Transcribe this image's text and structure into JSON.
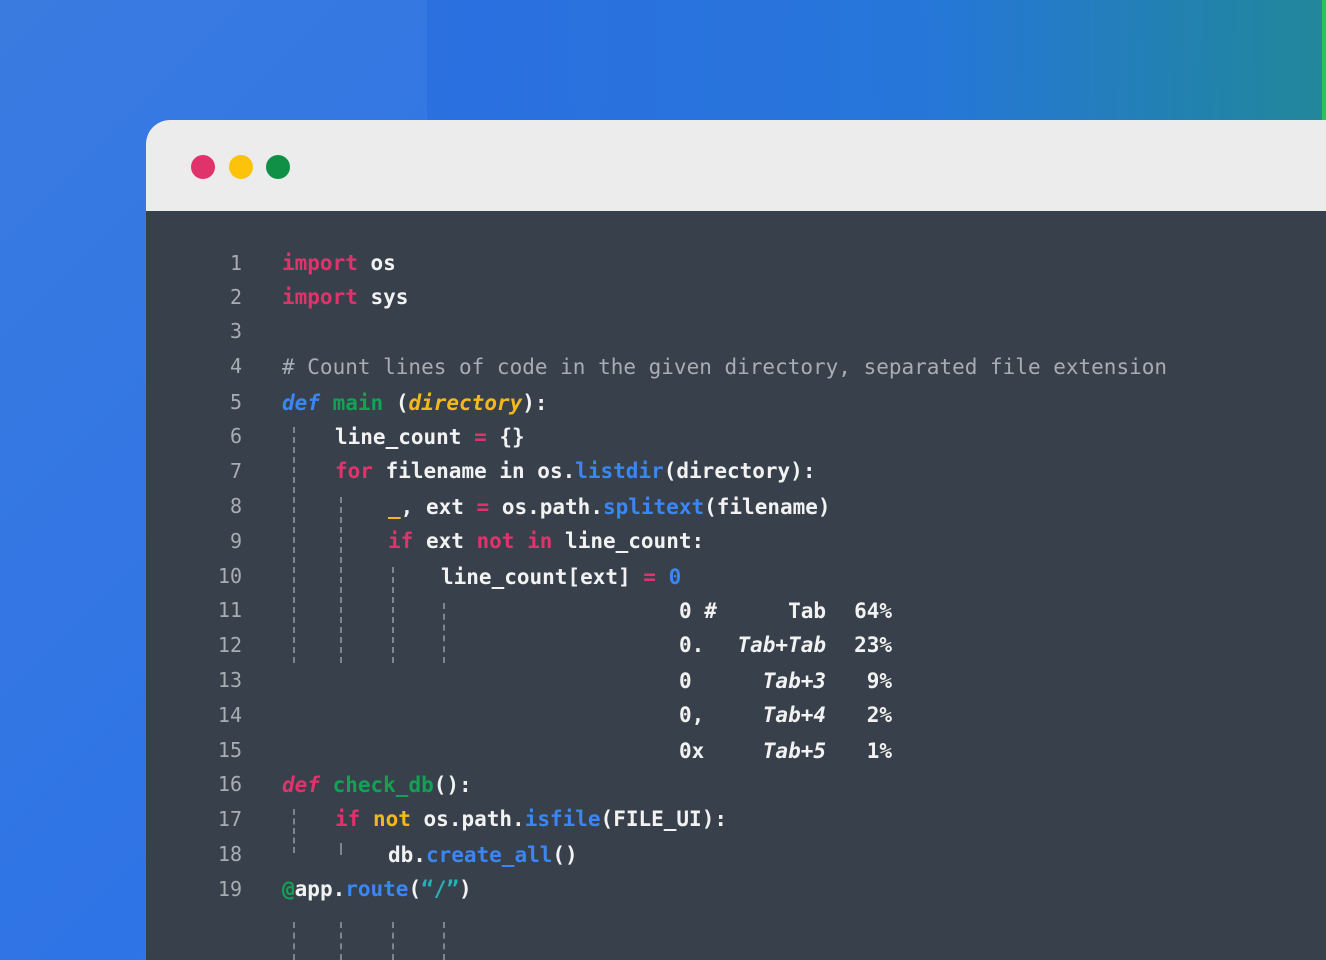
{
  "window": {
    "controls": [
      "close",
      "minimize",
      "maximize"
    ],
    "colors": {
      "close": "#e0336b",
      "minimize": "#fdc20a",
      "maximize": "#109046"
    }
  },
  "editor": {
    "line_numbers": [
      "1",
      "2",
      "3",
      "4",
      "5",
      "6",
      "7",
      "8",
      "9",
      "10",
      "11",
      "12",
      "13",
      "14",
      "15",
      "16",
      "17",
      "18",
      "19"
    ],
    "lines": {
      "l1": {
        "kw": "import",
        "rest": " os"
      },
      "l2": {
        "kw": "import",
        "rest": " sys"
      },
      "l4": {
        "comment": "# Count lines of code in the given directory, separated file extension"
      },
      "l5": {
        "kw": "def",
        "sp": " ",
        "fn": "main",
        "open": " (",
        "param": "directory",
        "close": "):"
      },
      "l6": {
        "a": "line_count ",
        "op": "=",
        "b": " {}"
      },
      "l7": {
        "kw": "for",
        "a": " filename in os.",
        "mth": "listdir",
        "b": "(directory):"
      },
      "l8": {
        "us": "_",
        "a": ", ext ",
        "op": "=",
        "b": " os.path.",
        "mth": "splitext",
        "c": "(filename)"
      },
      "l9": {
        "kw1": "if",
        "a": " ext ",
        "kw2": "not",
        "sp": " ",
        "kw3": "in",
        "b": " line_count:"
      },
      "l10": {
        "a": "line_count[ext] ",
        "op": "=",
        "sp": " ",
        "num": "0"
      },
      "l11": {
        "prefix": "0 #",
        "key": "Tab",
        "pct": "64%"
      },
      "l12": {
        "prefix": "0.",
        "key": "Tab+Tab",
        "pct": "23%"
      },
      "l13": {
        "prefix": "0",
        "key": "Tab+3",
        "pct": "9%"
      },
      "l14": {
        "prefix": "0,",
        "key": "Tab+4",
        "pct": "2%"
      },
      "l15": {
        "prefix": "0x",
        "key": "Tab+5",
        "pct": "1%"
      },
      "l16": {
        "kw": "def",
        "sp": " ",
        "fn": "check_db",
        "b": "():"
      },
      "l17": {
        "kw1": "if",
        "sp": " ",
        "kw2": "not",
        "a": " os.path.",
        "mth": "isfile",
        "b": "(FILE_UI):"
      },
      "l18": {
        "a": "db.",
        "mth": "create_all",
        "b": "()"
      },
      "l19": {
        "at": "@",
        "a": "app.",
        "mth": "route",
        "b": "(",
        "str": "“/”",
        "c": ")"
      }
    }
  }
}
